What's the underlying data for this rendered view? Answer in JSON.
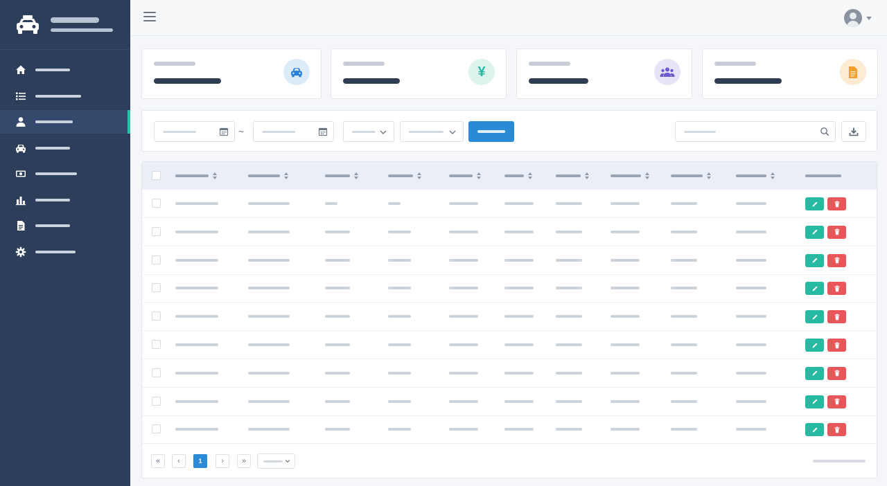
{
  "sidebar": {
    "logo_icon": "taxi-icon",
    "items": [
      {
        "icon": "home-icon",
        "active": false
      },
      {
        "icon": "list-icon",
        "active": false
      },
      {
        "icon": "user-icon",
        "active": true
      },
      {
        "icon": "car-icon",
        "active": false
      },
      {
        "icon": "cash-icon",
        "active": false
      },
      {
        "icon": "chart-icon",
        "active": false
      },
      {
        "icon": "document-icon",
        "active": false
      },
      {
        "icon": "gear-icon",
        "active": false
      }
    ]
  },
  "topbar": {
    "menu_icon": "hamburger-icon",
    "user_icon": "avatar-icon"
  },
  "stat_cards": [
    {
      "icon": "car-icon",
      "icon_color": "#2a7fd6",
      "bg_color": "#dcebf8"
    },
    {
      "icon": "yen-icon",
      "glyph": "¥",
      "icon_color": "#27b9a1",
      "bg_color": "#ddf4ee"
    },
    {
      "icon": "users-icon",
      "icon_color": "#6c5ad0",
      "bg_color": "#e8e4f7"
    },
    {
      "icon": "document-icon",
      "icon_color": "#f0a030",
      "bg_color": "#fdebd3"
    }
  ],
  "filters": {
    "range_separator": "~",
    "date_icon": "calendar-icon",
    "search_icon": "search-icon",
    "export_icon": "download-icon"
  },
  "table": {
    "row_count": 9,
    "actions": [
      "edit-icon",
      "trash-icon"
    ]
  },
  "pagination": {
    "current_page": "1",
    "first": "«",
    "prev": "‹",
    "next": "›",
    "last": "»"
  },
  "colors": {
    "sidebar_bg": "#2c3e5a",
    "accent_teal": "#2ebfa5",
    "primary_blue": "#2a8ad6",
    "danger_red": "#e8565a",
    "success_teal": "#27b9a1"
  }
}
